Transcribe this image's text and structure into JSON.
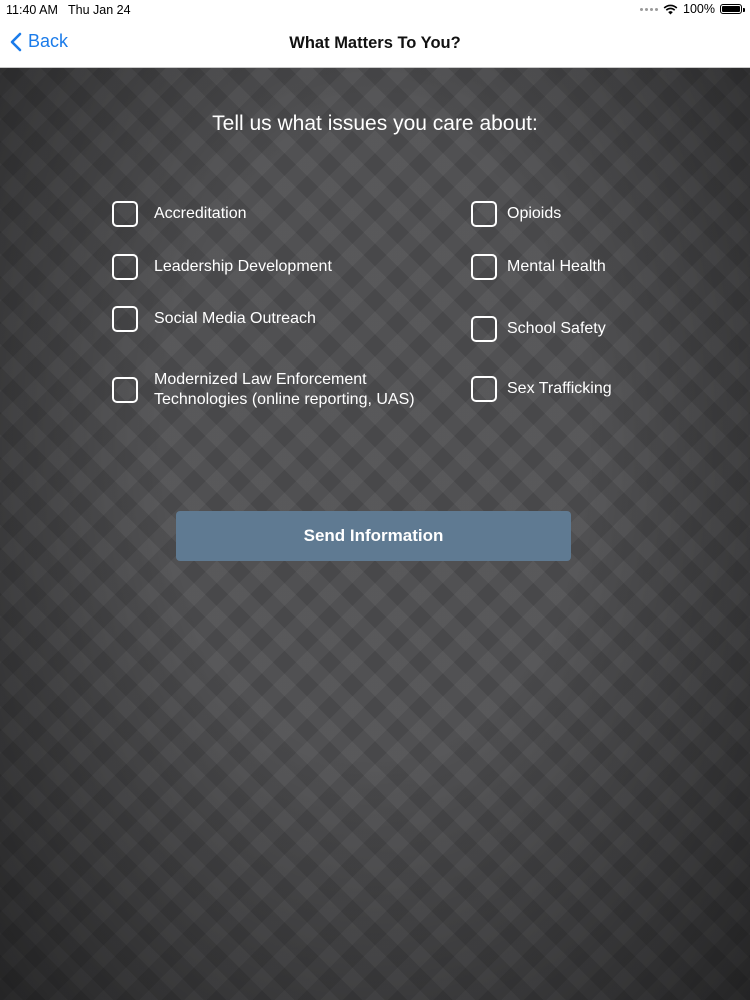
{
  "status_bar": {
    "time": "11:40 AM",
    "date": "Thu Jan 24",
    "battery_percent": "100%",
    "icons": [
      "signal-dots-icon",
      "wifi-icon",
      "battery-icon"
    ]
  },
  "nav": {
    "back_label": "Back",
    "title": "What Matters To You?"
  },
  "main": {
    "heading": "Tell us what issues you care about:",
    "options_left": [
      {
        "label": "Accreditation",
        "checked": false
      },
      {
        "label": "Leadership Development",
        "checked": false
      },
      {
        "label": "Social Media Outreach",
        "checked": false
      },
      {
        "label": "Modernized Law Enforcement\nTechnologies (online reporting, UAS)",
        "checked": false
      }
    ],
    "options_right": [
      {
        "label": "Opioids",
        "checked": false
      },
      {
        "label": "Mental Health",
        "checked": false
      },
      {
        "label": "School Safety",
        "checked": false
      },
      {
        "label": "Sex Trafficking",
        "checked": false
      }
    ],
    "send_button_label": "Send Information"
  },
  "colors": {
    "accent": "#1a7bea",
    "button": "#5f7a92",
    "background": "#4d4d4f"
  }
}
